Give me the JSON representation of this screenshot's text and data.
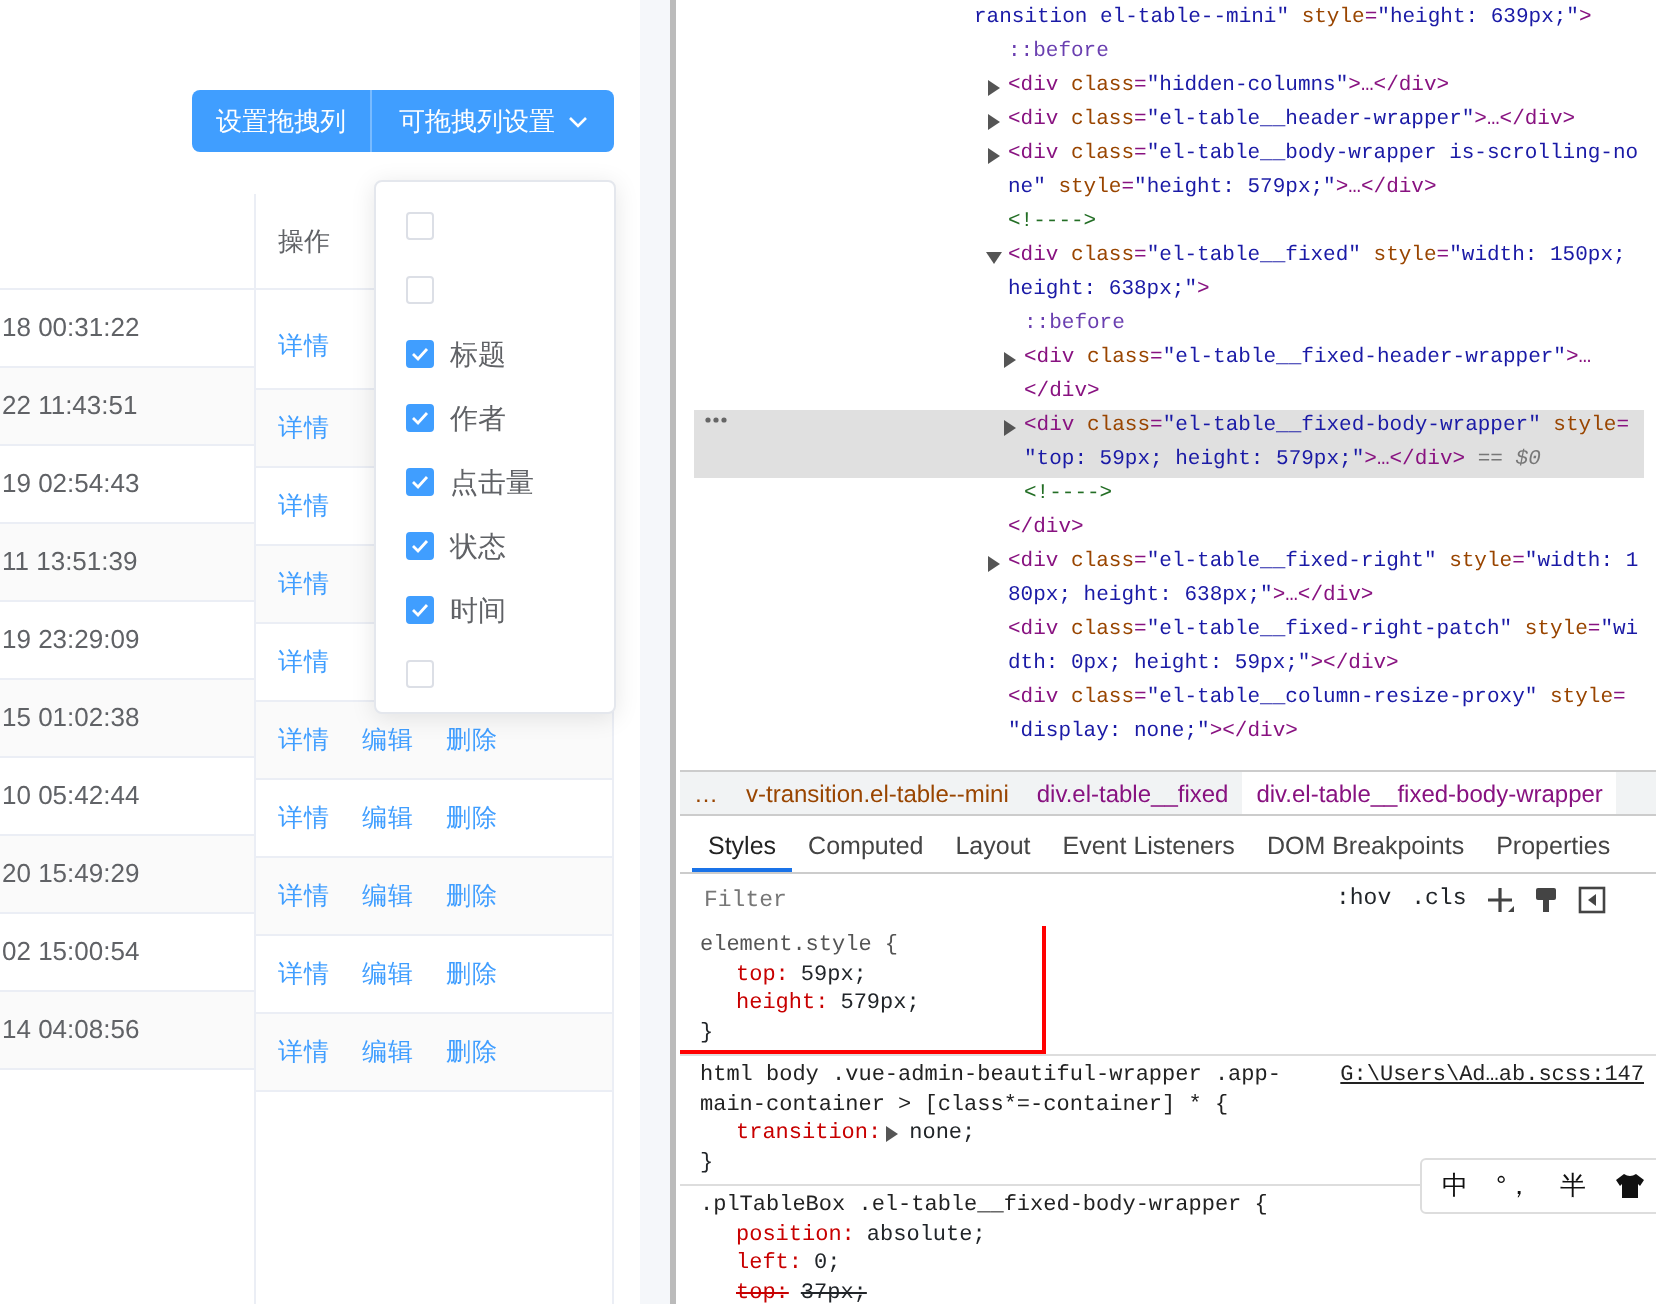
{
  "page": {
    "toolbar": {
      "buttons": [
        {
          "label": "设置拖拽列",
          "dropdown": false
        },
        {
          "label": "可拖拽列设置",
          "dropdown": true
        }
      ]
    },
    "table": {
      "action_header": "操作",
      "rows": [
        {
          "column_1": "18 00:31:22",
          "actions": [
            "详情"
          ]
        },
        {
          "column_1": "22 11:43:51",
          "actions": [
            "详情"
          ]
        },
        {
          "column_1": "19 02:54:43",
          "actions": [
            "详情"
          ]
        },
        {
          "column_1": "11 13:51:39",
          "actions": [
            "详情"
          ]
        },
        {
          "column_1": "19 23:29:09",
          "actions": [
            "详情"
          ]
        },
        {
          "column_1": "15 01:02:38",
          "actions": [
            "详情",
            "编辑",
            "删除"
          ]
        },
        {
          "column_1": "10 05:42:44",
          "actions": [
            "详情",
            "编辑",
            "删除"
          ]
        },
        {
          "column_1": "20 15:49:29",
          "actions": [
            "详情",
            "编辑",
            "删除"
          ]
        },
        {
          "column_1": "02 15:00:54",
          "actions": [
            "详情",
            "编辑",
            "删除"
          ]
        },
        {
          "column_1": "14 04:08:56",
          "actions": [
            "详情",
            "编辑",
            "删除"
          ]
        }
      ]
    },
    "column_menu": {
      "items": [
        {
          "checked": false
        },
        {
          "checked": false
        },
        {
          "label": "标题",
          "checked": true
        },
        {
          "label": "作者",
          "checked": true
        },
        {
          "label": "点击量",
          "checked": true
        },
        {
          "label": "状态",
          "checked": true
        },
        {
          "label": "时间",
          "checked": true
        },
        {
          "checked": false
        }
      ]
    }
  },
  "devtools": {
    "elements": {
      "selected": false,
      "lines": [
        [
          {
            "kind": "val",
            "text": "ransition el-table--mini\""
          },
          {
            "kind": "attr",
            "text": " style"
          },
          {
            "kind": "tag",
            "text": "="
          },
          {
            "kind": "val",
            "text": "\"height: 639px;\""
          },
          {
            "kind": "tag",
            "text": ">"
          }
        ]
      ],
      "children": [
        {
          "selected": false,
          "lines": [
            [
              {
                "kind": "pseudo",
                "text": "::before"
              }
            ]
          ]
        },
        {
          "selected": false,
          "expanded": false,
          "lines": [
            [
              {
                "kind": "tag",
                "text": "<div"
              },
              {
                "kind": "attr",
                "text": " class"
              },
              {
                "kind": "tag",
                "text": "="
              },
              {
                "kind": "val",
                "text": "\"hidden-columns\""
              },
              {
                "kind": "tag",
                "text": ">…</div>"
              }
            ]
          ]
        },
        {
          "selected": false,
          "expanded": false,
          "lines": [
            [
              {
                "kind": "tag",
                "text": "<div"
              },
              {
                "kind": "attr",
                "text": " class"
              },
              {
                "kind": "tag",
                "text": "="
              },
              {
                "kind": "val",
                "text": "\"el-table__header-wrapper\""
              },
              {
                "kind": "tag",
                "text": ">…</div>"
              }
            ]
          ]
        },
        {
          "selected": false,
          "expanded": false,
          "lines": [
            [
              {
                "kind": "tag",
                "text": "<div"
              },
              {
                "kind": "attr",
                "text": " class"
              },
              {
                "kind": "tag",
                "text": "="
              },
              {
                "kind": "val",
                "text": "\"el-table__body-wrapper is-scrolling-no"
              }
            ],
            [
              {
                "kind": "val",
                "text": "ne\""
              },
              {
                "kind": "attr",
                "text": " style"
              },
              {
                "kind": "tag",
                "text": "="
              },
              {
                "kind": "val",
                "text": "\"height: 579px;\""
              },
              {
                "kind": "tag",
                "text": ">…</div>"
              }
            ]
          ]
        },
        {
          "selected": false,
          "lines": [
            [
              {
                "kind": "cmt",
                "text": "<!---->"
              }
            ]
          ]
        },
        {
          "selected": false,
          "expanded": true,
          "lines": [
            [
              {
                "kind": "tag",
                "text": "<div"
              },
              {
                "kind": "attr",
                "text": " class"
              },
              {
                "kind": "tag",
                "text": "="
              },
              {
                "kind": "val",
                "text": "\"el-table__fixed\""
              },
              {
                "kind": "attr",
                "text": " style"
              },
              {
                "kind": "tag",
                "text": "="
              },
              {
                "kind": "val",
                "text": "\"width: 150px;"
              }
            ],
            [
              {
                "kind": "val",
                "text": "height: 638px;\""
              },
              {
                "kind": "tag",
                "text": ">"
              }
            ]
          ],
          "children": [
            {
              "selected": false,
              "lines": [
                [
                  {
                    "kind": "pseudo",
                    "text": "::before"
                  }
                ]
              ]
            },
            {
              "selected": false,
              "expanded": false,
              "lines": [
                [
                  {
                    "kind": "tag",
                    "text": "<div"
                  },
                  {
                    "kind": "attr",
                    "text": " class"
                  },
                  {
                    "kind": "tag",
                    "text": "="
                  },
                  {
                    "kind": "val",
                    "text": "\"el-table__fixed-header-wrapper\""
                  },
                  {
                    "kind": "tag",
                    "text": ">…"
                  }
                ],
                [
                  {
                    "kind": "tag",
                    "text": "</div>"
                  }
                ]
              ]
            },
            {
              "selected": true,
              "expanded": false,
              "lines": [
                [
                  {
                    "kind": "tag",
                    "text": "<div"
                  },
                  {
                    "kind": "attr",
                    "text": " class"
                  },
                  {
                    "kind": "tag",
                    "text": "="
                  },
                  {
                    "kind": "val",
                    "text": "\"el-table__fixed-body-wrapper\""
                  },
                  {
                    "kind": "attr",
                    "text": " style"
                  },
                  {
                    "kind": "tag",
                    "text": "="
                  }
                ],
                [
                  {
                    "kind": "val",
                    "text": "\"top: 59px; height: 579px;\""
                  },
                  {
                    "kind": "tag",
                    "text": ">…</div>"
                  },
                  {
                    "kind": "ref",
                    "text": " == $0"
                  }
                ]
              ]
            },
            {
              "selected": false,
              "lines": [
                [
                  {
                    "kind": "cmt",
                    "text": "<!---->"
                  }
                ]
              ]
            }
          ],
          "closing": [
            {
              "kind": "tag",
              "text": "</div>"
            }
          ]
        },
        {
          "selected": false,
          "expanded": false,
          "lines": [
            [
              {
                "kind": "tag",
                "text": "<div"
              },
              {
                "kind": "attr",
                "text": " class"
              },
              {
                "kind": "tag",
                "text": "="
              },
              {
                "kind": "val",
                "text": "\"el-table__fixed-right\""
              },
              {
                "kind": "attr",
                "text": " style"
              },
              {
                "kind": "tag",
                "text": "="
              },
              {
                "kind": "val",
                "text": "\"width: 1"
              }
            ],
            [
              {
                "kind": "val",
                "text": "80px; height: 638px;\""
              },
              {
                "kind": "tag",
                "text": ">…</div>"
              }
            ]
          ]
        },
        {
          "selected": false,
          "lines": [
            [
              {
                "kind": "tag",
                "text": "<div"
              },
              {
                "kind": "attr",
                "text": " class"
              },
              {
                "kind": "tag",
                "text": "="
              },
              {
                "kind": "val",
                "text": "\"el-table__fixed-right-patch\""
              },
              {
                "kind": "attr",
                "text": " style"
              },
              {
                "kind": "tag",
                "text": "="
              },
              {
                "kind": "val",
                "text": "\"wi"
              }
            ],
            [
              {
                "kind": "val",
                "text": "dth: 0px; height: 59px;\""
              },
              {
                "kind": "tag",
                "text": "></div>"
              }
            ]
          ]
        },
        {
          "selected": false,
          "lines": [
            [
              {
                "kind": "tag",
                "text": "<div"
              },
              {
                "kind": "attr",
                "text": " class"
              },
              {
                "kind": "tag",
                "text": "="
              },
              {
                "kind": "val",
                "text": "\"el-table__column-resize-proxy\""
              },
              {
                "kind": "attr",
                "text": " style"
              },
              {
                "kind": "tag",
                "text": "="
              }
            ],
            [
              {
                "kind": "val",
                "text": "\"display: none;\""
              },
              {
                "kind": "tag",
                "text": "></div>"
              }
            ]
          ]
        }
      ]
    },
    "breadcrumbs": [
      {
        "cls": "…",
        "selected": false
      },
      {
        "cls": "v-transition.el-table--mini",
        "selected": false
      },
      {
        "tag": "div",
        "cls": ".el-table__fixed",
        "selected": false
      },
      {
        "tag": "div",
        "cls": ".el-table__fixed-body-wrapper",
        "selected": true
      }
    ],
    "tabs": [
      {
        "label": "Styles",
        "selected": true
      },
      {
        "label": "Computed",
        "selected": false
      },
      {
        "label": "Layout",
        "selected": false
      },
      {
        "label": "Event Listeners",
        "selected": false
      },
      {
        "label": "DOM Breakpoints",
        "selected": false
      },
      {
        "label": "Properties",
        "selected": false
      }
    ],
    "filter": {
      "placeholder": "Filter"
    },
    "toggles": [
      ":hov",
      ".cls"
    ],
    "rules": [
      {
        "selector": "element.style {",
        "highlighted": true,
        "declarations": [
          {
            "property": "top:",
            "value": "59px;",
            "overridden": false
          },
          {
            "property": "height:",
            "value": "579px;",
            "overridden": false
          }
        ],
        "closing": "}"
      },
      {
        "selector": "html body .vue-admin-beautiful-wrapper .app-main-container > [class*=-container] * {",
        "source": "G:\\Users\\Ad…ab.scss:147",
        "highlighted": false,
        "declarations": [
          {
            "property": "transition:",
            "value": "none;",
            "expandable": true,
            "overridden": false
          }
        ],
        "closing": "}"
      },
      {
        "selector": ".plTableBox .el-table__fixed-body-wrapper {",
        "highlighted": false,
        "declarations": [
          {
            "property": "position:",
            "value": "absolute;",
            "overridden": false
          },
          {
            "property": "left:",
            "value": "0;",
            "overridden": false
          },
          {
            "property": "top:",
            "value": "37px;",
            "overridden": true
          }
        ]
      }
    ]
  },
  "ime_bar": {
    "items": [
      "中",
      "°，",
      "半"
    ]
  }
}
